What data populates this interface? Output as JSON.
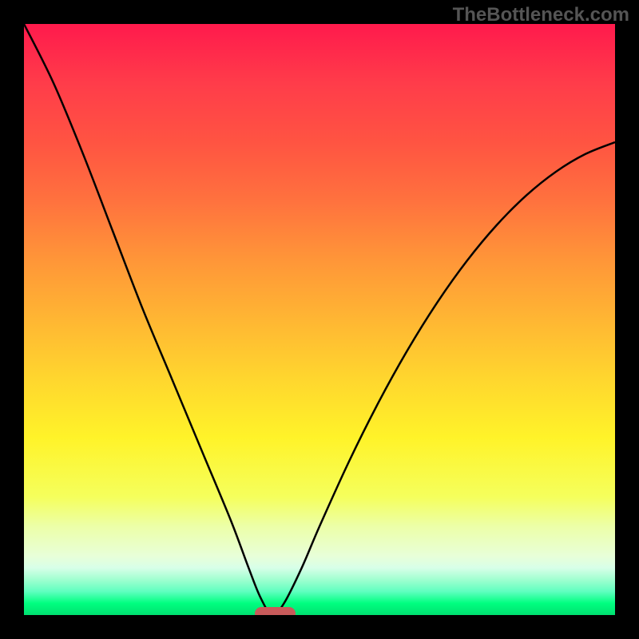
{
  "watermark": "TheBottleneck.com",
  "chart_data": {
    "type": "line",
    "title": "",
    "xlabel": "",
    "ylabel": "",
    "x_range": [
      0,
      100
    ],
    "y_range": [
      0,
      100
    ],
    "curve_minimum_x": 42,
    "curve": [
      {
        "x": 0,
        "y": 100
      },
      {
        "x": 5,
        "y": 90
      },
      {
        "x": 10,
        "y": 78
      },
      {
        "x": 15,
        "y": 65
      },
      {
        "x": 20,
        "y": 52
      },
      {
        "x": 25,
        "y": 40
      },
      {
        "x": 30,
        "y": 28
      },
      {
        "x": 35,
        "y": 16
      },
      {
        "x": 38,
        "y": 8
      },
      {
        "x": 40,
        "y": 3
      },
      {
        "x": 42,
        "y": 0
      },
      {
        "x": 44,
        "y": 2
      },
      {
        "x": 47,
        "y": 8
      },
      {
        "x": 50,
        "y": 15
      },
      {
        "x": 55,
        "y": 26
      },
      {
        "x": 60,
        "y": 36
      },
      {
        "x": 65,
        "y": 45
      },
      {
        "x": 70,
        "y": 53
      },
      {
        "x": 75,
        "y": 60
      },
      {
        "x": 80,
        "y": 66
      },
      {
        "x": 85,
        "y": 71
      },
      {
        "x": 90,
        "y": 75
      },
      {
        "x": 95,
        "y": 78
      },
      {
        "x": 100,
        "y": 80
      }
    ],
    "marker": {
      "x_start": 39,
      "x_end": 46,
      "y": 0,
      "color": "#c85a5a"
    },
    "gradient_colors": {
      "top": "#ff1a4c",
      "bottom": "#00e070"
    }
  }
}
